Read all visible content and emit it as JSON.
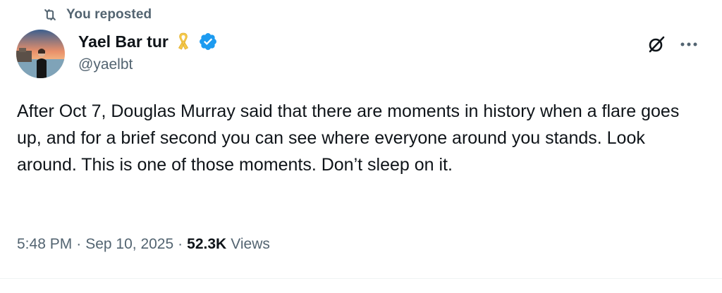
{
  "repost": {
    "icon": "repost-icon",
    "label": "You reposted"
  },
  "author": {
    "avatar_icon": "avatar",
    "display_name": "Yael Bar tur",
    "badge_icons": [
      "yellow-ribbon-icon",
      "verified-badge-icon"
    ],
    "handle": "@yaelbt"
  },
  "actions": {
    "grok_icon": "grok-icon",
    "more_icon": "more-icon"
  },
  "tweet": {
    "text": "After Oct 7, Douglas Murray said that there are moments in history when a flare goes up, and for a brief second you can see where everyone around you stands. Look around. This is one of those moments. Don’t sleep on it."
  },
  "meta": {
    "time": "5:48 PM",
    "separator": "·",
    "date": "Sep 10, 2025",
    "views_count": "52.3K",
    "views_label": "Views"
  },
  "colors": {
    "text_primary": "#0f1419",
    "text_secondary": "#536471",
    "verified_blue": "#1d9bf0",
    "ribbon_yellow": "#f4c84a"
  }
}
